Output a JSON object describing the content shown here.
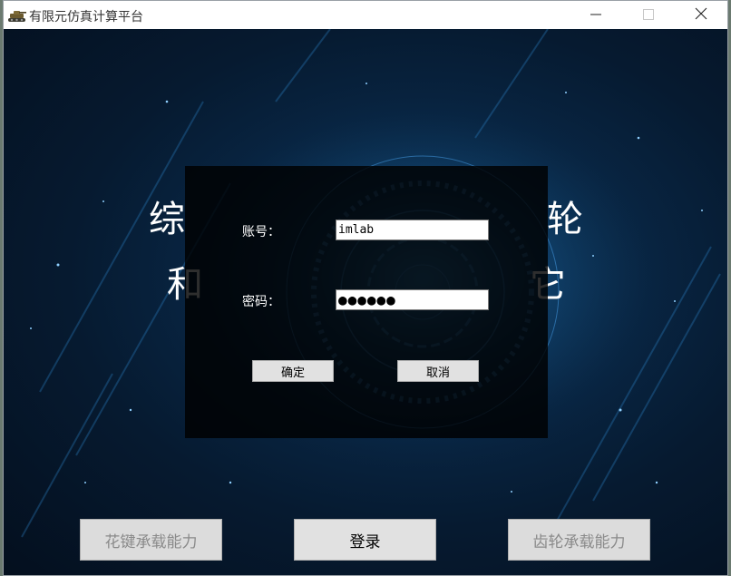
{
  "window": {
    "title": "有限元仿真计算平台",
    "icon": "tank-icon",
    "controls": {
      "minimize": "minimize-icon",
      "maximize": "maximize-icon",
      "close": "close-icon"
    }
  },
  "background": {
    "heading_left_top": "综",
    "heading_left_bottom": "和",
    "heading_right_top": "轮",
    "heading_right_bottom": "它"
  },
  "login": {
    "account_label": "账号：",
    "account_value": "imlab",
    "password_label": "密码：",
    "password_value": "●●●●●●",
    "confirm_label": "确定",
    "cancel_label": "取消"
  },
  "bottom_buttons": {
    "spline": "花键承载能力",
    "login": "登录",
    "gear": "齿轮承载能力"
  },
  "colors": {
    "background_dark": "#061a30",
    "background_glow": "#1b5a8a",
    "dialog_bg": "#000000",
    "button_bg": "#e1e1e1",
    "disabled_text": "#8a8a8a"
  }
}
